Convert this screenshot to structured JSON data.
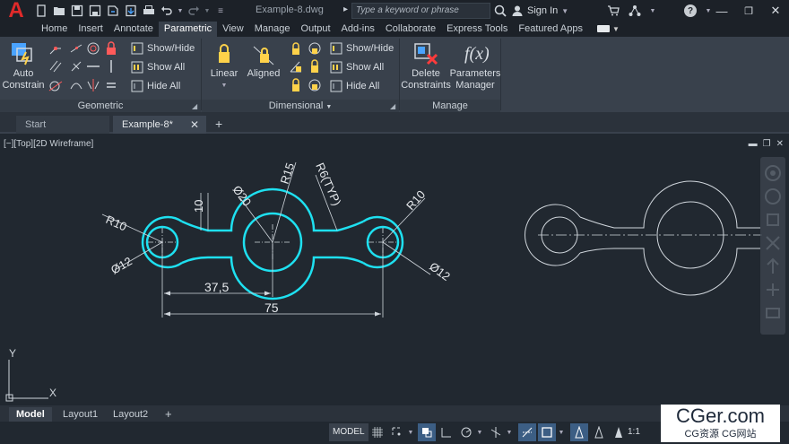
{
  "titlebar": {
    "logo": "A",
    "document_title": "Example-8.dwg",
    "search_placeholder": "Type a keyword or phrase",
    "signin_label": "Sign In",
    "help_label": "?"
  },
  "ribbon_tabs": [
    "Home",
    "Insert",
    "Annotate",
    "Parametric",
    "View",
    "Manage",
    "Output",
    "Add-ins",
    "Collaborate",
    "Express Tools",
    "Featured Apps"
  ],
  "active_tab": "Parametric",
  "ribbon": {
    "geometric": {
      "auto_constrain": "Auto Constrain",
      "show_hide": "Show/Hide",
      "show_all": "Show All",
      "hide_all": "Hide All",
      "title": "Geometric"
    },
    "dimensional": {
      "linear": "Linear",
      "aligned": "Aligned",
      "show_hide": "Show/Hide",
      "show_all": "Show All",
      "hide_all": "Hide All",
      "title": "Dimensional"
    },
    "manage": {
      "delete_constraints": "Delete Constraints",
      "parameters_manager": "Parameters Manager",
      "title": "Manage"
    }
  },
  "file_tabs": {
    "start": "Start",
    "example": "Example-8*"
  },
  "viewport": {
    "label": "[−][Top][2D Wireframe]",
    "dimensions": {
      "r10_left": "R10",
      "dia12_left": "Ø12",
      "ten": "10",
      "dia20": "Ø20",
      "r15": "R15",
      "r6_typ": "R6(TYP)",
      "r10_right": "R10",
      "dia12_right": "Ø12",
      "d37_5": "37,5",
      "d75": "75"
    },
    "ucs": {
      "y": "Y",
      "x": "X"
    }
  },
  "layout_tabs": {
    "model": "Model",
    "layout1": "Layout1",
    "layout2": "Layout2"
  },
  "status": {
    "model": "MODEL",
    "scale": "1:1"
  },
  "colors": {
    "accent_cyan": "#1ee0f0",
    "background": "#212830",
    "ribbon": "#39414c",
    "active_status": "#3c5e84"
  },
  "watermark": {
    "main": "CGer.com",
    "sub": "CG资源 CG网站"
  }
}
